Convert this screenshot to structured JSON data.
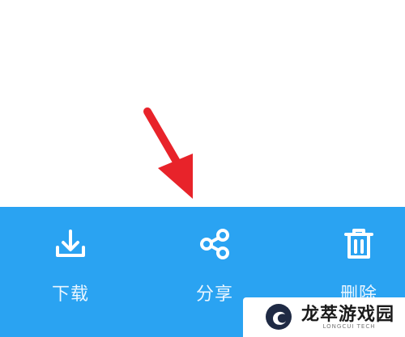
{
  "actions": [
    {
      "icon": "download-icon",
      "label": "下载"
    },
    {
      "icon": "share-icon",
      "label": "分享"
    },
    {
      "icon": "trash-icon",
      "label": "删除"
    }
  ],
  "colors": {
    "bar": "#2AA3F2",
    "arrow": "#E8232A",
    "icon": "#ffffff"
  },
  "watermark": {
    "title": "龙萃游戏园",
    "subtitle": "LONGCUI TECH"
  }
}
